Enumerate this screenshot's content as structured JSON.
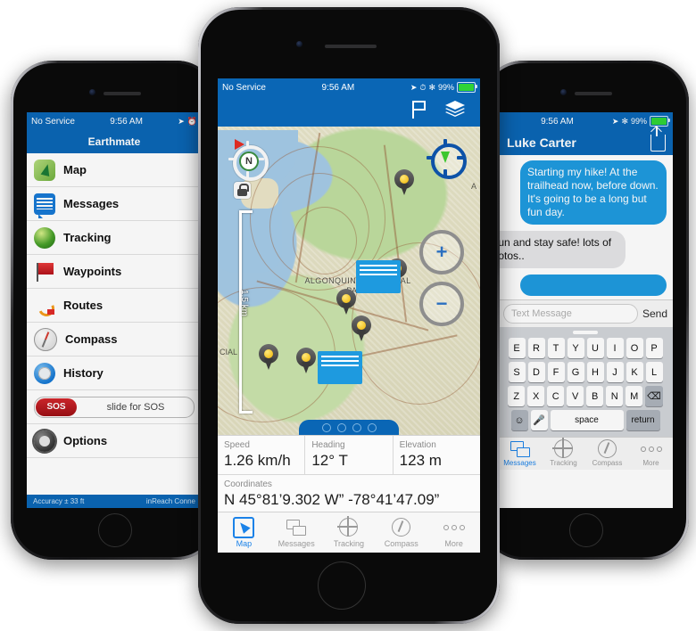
{
  "status_bar": {
    "carrier": "No Service",
    "wifi_icon": "wifi-icon",
    "time": "9:56 AM",
    "location_icon": "location-arrow-icon",
    "alarm_icon": "alarm-icon",
    "bluetooth_icon": "bluetooth-icon",
    "battery_percent": "99%"
  },
  "left_phone": {
    "title": "Earthmate",
    "menu_items": [
      {
        "label": "Map",
        "icon": "map-icon"
      },
      {
        "label": "Messages",
        "icon": "messages-icon"
      },
      {
        "label": "Tracking",
        "icon": "tracking-icon"
      },
      {
        "label": "Waypoints",
        "icon": "waypoints-flag-icon"
      },
      {
        "label": "Routes",
        "icon": "routes-icon"
      },
      {
        "label": "Compass",
        "icon": "compass-icon"
      },
      {
        "label": "History",
        "icon": "history-clock-icon"
      }
    ],
    "sos": {
      "button_label": "SOS",
      "slider_label": "slide for SOS"
    },
    "options": {
      "label": "Options",
      "icon": "gear-icon"
    },
    "footer": {
      "accuracy": "Accuracy ± 33 ft",
      "connection": "inReach Conne"
    }
  },
  "center_phone": {
    "navbar": {
      "flag_icon": "flag-icon",
      "layers_icon": "layers-icon"
    },
    "map": {
      "park_label_line1": "ALGONQUIN PROVINCIAL",
      "park_label_line2": "PARK",
      "edge_label": "A",
      "left_edge_label": "CIAL",
      "compass_letter": "N",
      "compass_icon": "compass-rose-icon",
      "lock_icon": "lock-icon",
      "scale_label": "1.5 km",
      "locate_icon": "locate-me-icon",
      "zoom_in_label": "+",
      "zoom_out_label": "−",
      "waypoint_count": 6,
      "message_pin_count": 2,
      "page_dots": 4
    },
    "data_panel": {
      "cells": [
        {
          "label": "Speed",
          "value": "1.26 km/h"
        },
        {
          "label": "Heading",
          "value": "12° T"
        },
        {
          "label": "Elevation",
          "value": "123 m"
        }
      ],
      "coordinates_label": "Coordinates",
      "coordinates_value": "N 45°81’9.302 W” -78°41’47.09”"
    },
    "tabs": [
      {
        "label": "Map",
        "icon": "map-arrow-icon",
        "selected": true
      },
      {
        "label": "Messages",
        "icon": "messages-icon",
        "selected": false
      },
      {
        "label": "Tracking",
        "icon": "tracking-crosshair-icon",
        "selected": false
      },
      {
        "label": "Compass",
        "icon": "compass-icon",
        "selected": false
      },
      {
        "label": "More",
        "icon": "more-dots-icon",
        "selected": false
      }
    ]
  },
  "right_phone": {
    "title": "Luke Carter",
    "share_icon": "share-icon",
    "messages": [
      {
        "from": "out",
        "text": "Starting my hike! At the trailhead now, before down. It's going to be a long but fun day."
      },
      {
        "from": "in",
        "text": "e fun and stay safe! lots of photos.."
      }
    ],
    "composer": {
      "placeholder": "Text Message",
      "send_label": "Send"
    },
    "keyboard": {
      "row1": [
        "E",
        "R",
        "T",
        "Y",
        "U",
        "I",
        "O",
        "P"
      ],
      "row2": [
        "S",
        "D",
        "F",
        "G",
        "H",
        "J",
        "K",
        "L"
      ],
      "row3": [
        "Z",
        "X",
        "C",
        "V",
        "B",
        "N",
        "M"
      ],
      "backspace_icon": "backspace-icon",
      "emoji_icon": "emoji-icon",
      "mic_icon": "microphone-icon",
      "space_label": "space",
      "return_label": "return"
    },
    "tabs": [
      {
        "label": "Messages",
        "icon": "messages-icon",
        "selected": true
      },
      {
        "label": "Tracking",
        "icon": "tracking-crosshair-icon",
        "selected": false
      },
      {
        "label": "Compass",
        "icon": "compass-icon",
        "selected": false
      },
      {
        "label": "More",
        "icon": "more-dots-icon",
        "selected": false
      }
    ]
  },
  "colors": {
    "nav_blue": "#0a66b5",
    "accent_blue": "#1b82e8",
    "bubble_blue": "#1e9adf",
    "sos_red": "#c2161c"
  }
}
